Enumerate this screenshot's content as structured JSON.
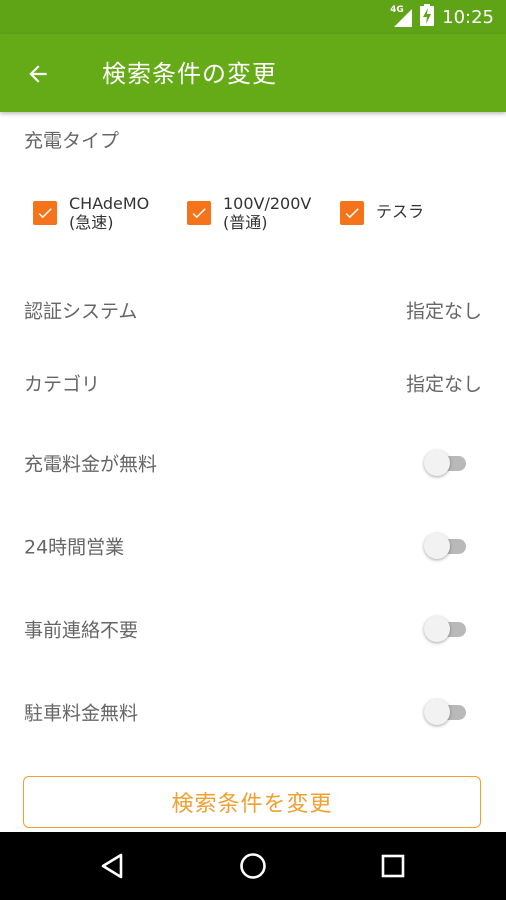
{
  "status_bar": {
    "network": "4G",
    "time": "10:25",
    "icons": [
      "signal-icon",
      "battery-charging-icon"
    ]
  },
  "app_bar": {
    "title": "検索条件の変更",
    "back_icon": "arrow-left-icon"
  },
  "charge_type": {
    "label": "充電タイプ",
    "options": [
      {
        "line1": "CHAdeMO",
        "line2": "(急速)",
        "checked": true
      },
      {
        "line1": "100V/200V",
        "line2": "(普通)",
        "checked": true
      },
      {
        "line1": "テスラ",
        "line2": "",
        "checked": true
      }
    ]
  },
  "settings": [
    {
      "label": "認証システム",
      "value": "指定なし"
    },
    {
      "label": "カテゴリ",
      "value": "指定なし"
    }
  ],
  "toggles": [
    {
      "label": "充電料金が無料",
      "on": false
    },
    {
      "label": "24時間営業",
      "on": false
    },
    {
      "label": "事前連絡不要",
      "on": false
    },
    {
      "label": "駐車料金無料",
      "on": false
    }
  ],
  "submit_label": "検索条件を変更",
  "colors": {
    "app_bar": "#65ab17",
    "checkbox": "#f5731b",
    "button_accent": "#f0a030"
  },
  "nav": [
    "back-triangle-icon",
    "home-circle-icon",
    "recents-square-icon"
  ]
}
